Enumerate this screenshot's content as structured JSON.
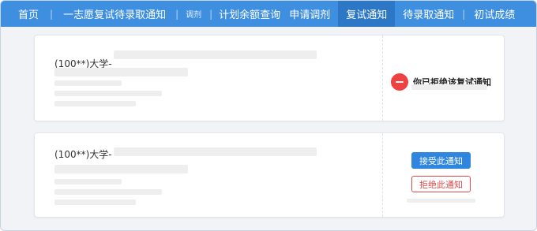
{
  "nav": {
    "items": [
      {
        "label": "首页"
      },
      {
        "label": "一志愿复试待录取通知"
      },
      {
        "label": "调剂"
      },
      {
        "label": "计划余额查询"
      },
      {
        "label": "申请调剂"
      },
      {
        "label": "复试通知",
        "active": true
      },
      {
        "label": "待录取通知"
      },
      {
        "label": "初试成绩"
      }
    ]
  },
  "cards": [
    {
      "university_prefix": "(100**)大学-",
      "status_text": "你已拒绝该复试通知"
    },
    {
      "university_prefix": "(100**)大学-",
      "accept_label": "接受此通知",
      "reject_label": "拒绝此通知"
    }
  ],
  "colors": {
    "nav_bg": "#3f8fe0",
    "nav_active": "#2d78c6",
    "accept": "#2e86de",
    "reject": "#e04a4a",
    "status_icon": "#f04142"
  },
  "icons": {
    "status": "minus-circle-icon"
  }
}
